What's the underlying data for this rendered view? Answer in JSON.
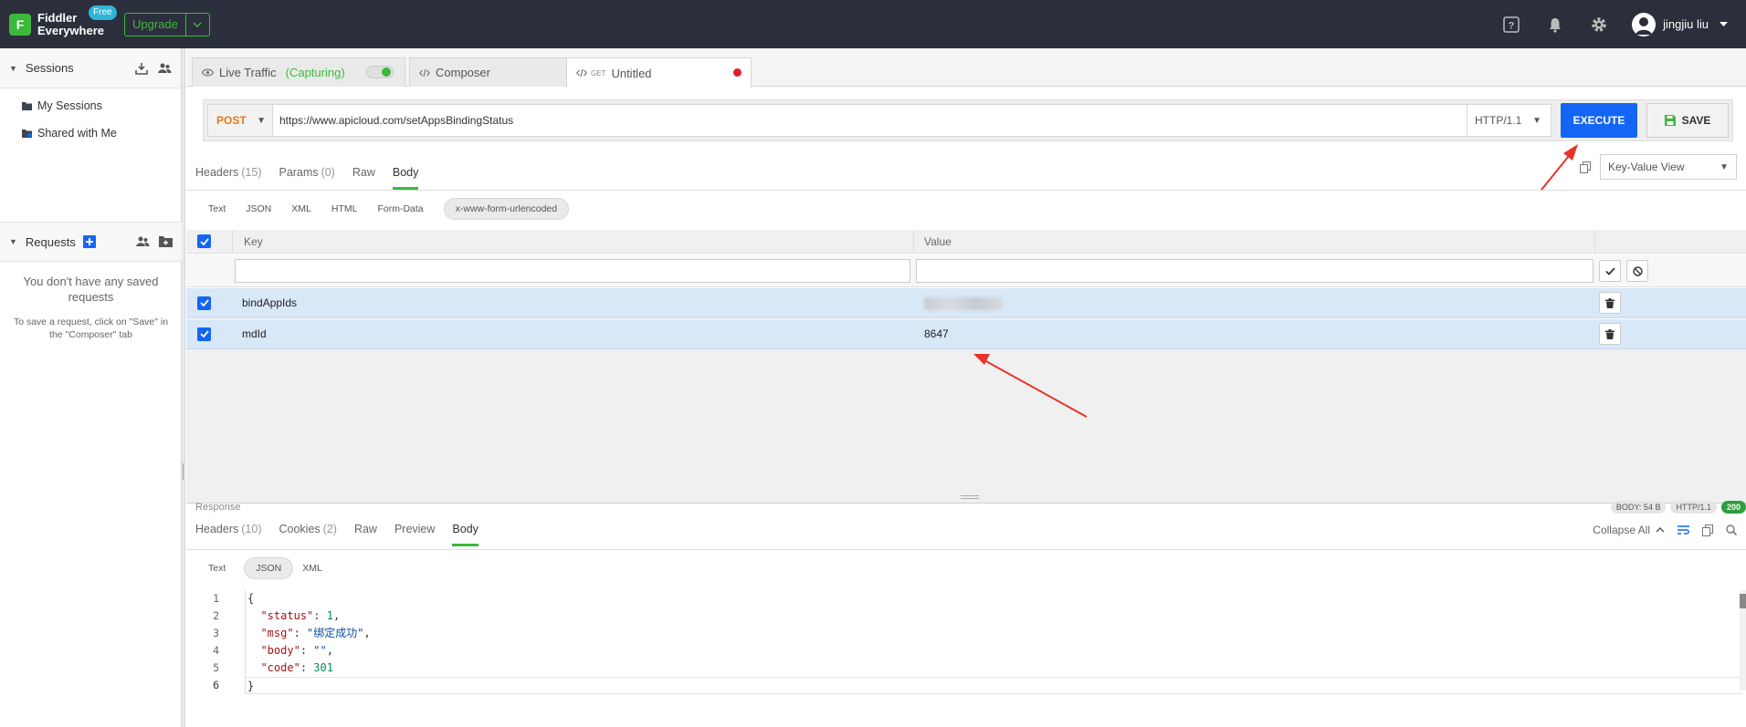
{
  "app": {
    "name_line1": "Fiddler",
    "name_line2": "Everywhere",
    "free_badge": "Free",
    "upgrade_label": "Upgrade",
    "logo_letter": "F",
    "user_name": "jingjiu liu"
  },
  "sidebar": {
    "sessions_title": "Sessions",
    "items": [
      {
        "label": "My Sessions"
      },
      {
        "label": "Shared with Me"
      }
    ],
    "requests_title": "Requests",
    "empty_title": "You don't have any saved requests",
    "empty_hint": "To save a request, click on \"Save\" in the \"Composer\" tab"
  },
  "tabs": [
    {
      "label": "Live Traffic",
      "status": "(Capturing)"
    },
    {
      "label": "Composer"
    },
    {
      "label": "Untitled",
      "badge": "GET"
    }
  ],
  "request": {
    "method": "POST",
    "url": "https://www.apicloud.com/setAppsBindingStatus",
    "protocol": "HTTP/1.1",
    "execute_label": "EXECUTE",
    "save_label": "SAVE",
    "tabs": [
      {
        "label": "Headers",
        "count": "(15)"
      },
      {
        "label": "Params",
        "count": "(0)"
      },
      {
        "label": "Raw"
      },
      {
        "label": "Body"
      }
    ],
    "view_mode": "Key-Value View",
    "body_types": [
      "Text",
      "JSON",
      "XML",
      "HTML",
      "Form-Data",
      "x-www-form-urlencoded"
    ],
    "table": {
      "col_key": "Key",
      "col_value": "Value",
      "rows": [
        {
          "key": "bindAppIds",
          "value": ""
        },
        {
          "key": "mdId",
          "value": "8647"
        }
      ]
    }
  },
  "response": {
    "label": "Response",
    "body_size": "BODY: 54 B",
    "protocol": "HTTP/1.1",
    "status_code": "200",
    "tabs": [
      {
        "label": "Headers",
        "count": "(10)"
      },
      {
        "label": "Cookies",
        "count": "(2)"
      },
      {
        "label": "Raw"
      },
      {
        "label": "Preview"
      },
      {
        "label": "Body"
      }
    ],
    "collapse_label": "Collapse All",
    "body_types": [
      "Text",
      "JSON",
      "XML"
    ],
    "lines": [
      "1",
      "2",
      "3",
      "4",
      "5",
      "6"
    ],
    "json": {
      "open": "{",
      "close": "}",
      "status_key": "\"status\"",
      "status_val": "1",
      "msg_key": "\"msg\"",
      "msg_val": "\"绑定成功\"",
      "body_key": "\"body\"",
      "body_val": "\"\"",
      "code_key": "\"code\"",
      "code_val": "301"
    }
  },
  "colors": {
    "accent_green": "#3cb83c",
    "execute_blue": "#1565f5",
    "method_orange": "#e27b1a",
    "annotation_red": "#e8332a"
  }
}
